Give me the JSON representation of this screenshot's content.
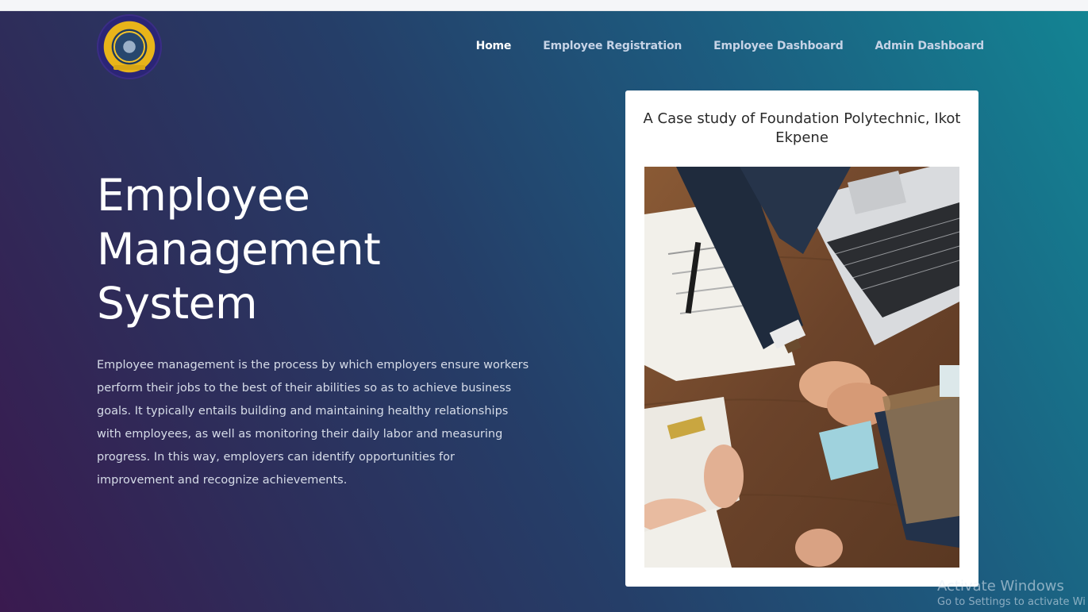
{
  "nav": {
    "home": "Home",
    "employee_registration": "Employee Registration",
    "employee_dashboard": "Employee Dashboard",
    "admin_dashboard": "Admin Dashboard"
  },
  "hero": {
    "title_line1": "Employee",
    "title_line2": "Management",
    "title_line3": "System",
    "description": "Employee management is the process by which employers ensure workers perform their jobs to the best of their abilities so as to achieve business goals. It typically entails building and maintaining healthy relationships with employees, as well as monitoring their daily labor and measuring progress. In this way, employers can identify opportunities for improvement and recognize achievements."
  },
  "card": {
    "title": "A Case study of Foundation Polytechnic, Ikot Ekpene"
  },
  "watermark": {
    "line1": "Activate Windows",
    "line2": "Go to Settings to activate Wi"
  },
  "colors": {
    "gradient_start": "#3a1a4f",
    "gradient_end": "#138493",
    "nav_active": "#ffffff",
    "nav_inactive": "#c6d3e6"
  }
}
